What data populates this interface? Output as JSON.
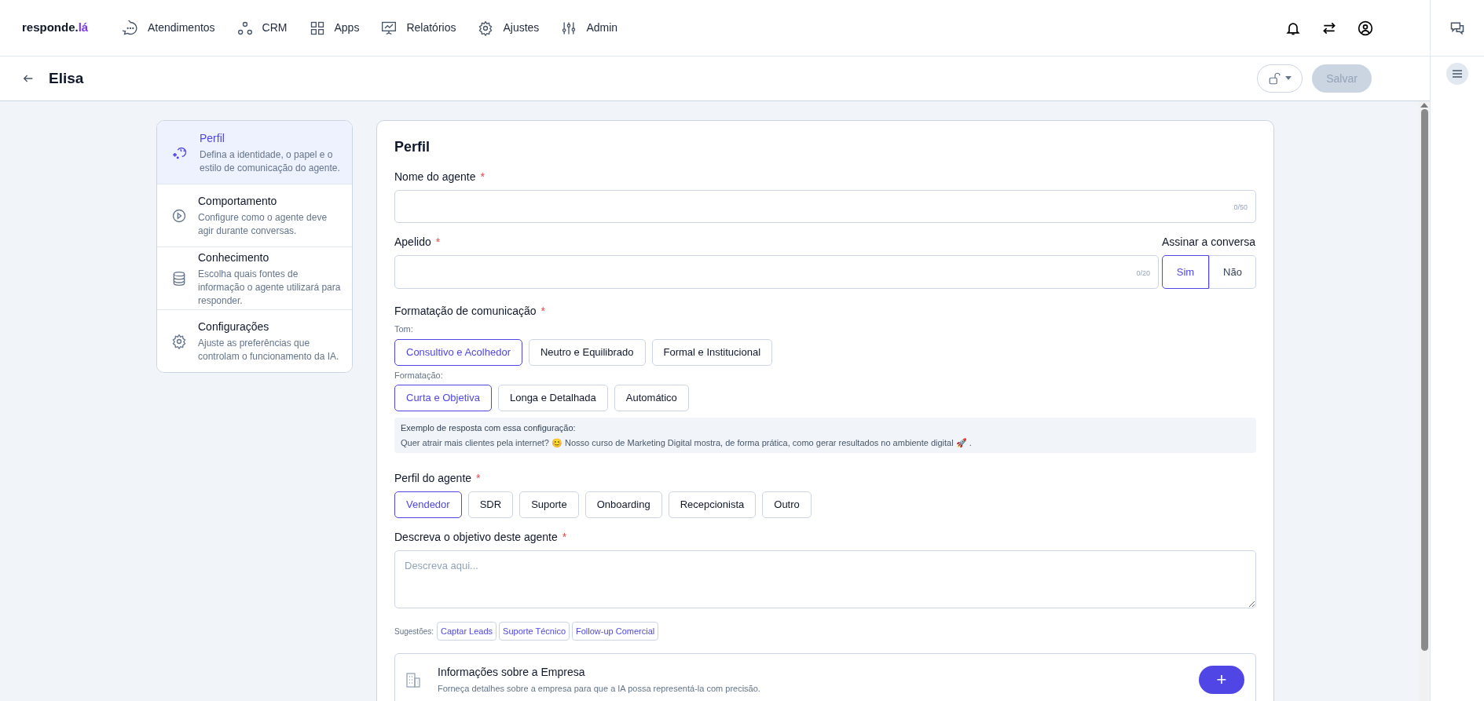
{
  "brand": {
    "name": "responde.",
    "suffix": "lá"
  },
  "nav": [
    {
      "label": "Atendimentos"
    },
    {
      "label": "CRM"
    },
    {
      "label": "Apps"
    },
    {
      "label": "Relatórios"
    },
    {
      "label": "Ajustes"
    },
    {
      "label": "Admin"
    }
  ],
  "header": {
    "title": "Elisa",
    "save_label": "Salvar",
    "save_disabled": true
  },
  "sections": [
    {
      "title": "Perfil",
      "description": "Defina a identidade, o papel e o estilo de comunicação do agente.",
      "selected": true
    },
    {
      "title": "Comportamento",
      "description": "Configure como o agente deve agir durante conversas.",
      "selected": false
    },
    {
      "title": "Conhecimento",
      "description": "Escolha quais fontes de informação o agente utilizará para responder.",
      "selected": false
    },
    {
      "title": "Configurações",
      "description": "Ajuste as preferências que controlam o funcionamento da IA.",
      "selected": false
    }
  ],
  "form": {
    "title": "Perfil",
    "name_field": {
      "label": "Nome do agente",
      "asterisk": "*",
      "counter": "0/50"
    },
    "nickname_field": {
      "label": "Apelido",
      "asterisk": "*",
      "counter": "0/20"
    },
    "sign": {
      "label": "Assinar a conversa",
      "options": [
        {
          "label": "Sim",
          "selected": true
        },
        {
          "label": "Não",
          "selected": false
        }
      ]
    },
    "formatting": {
      "label": "Formatação de comunicação",
      "asterisk": "*",
      "groups": [
        {
          "label": "Tom:",
          "options": [
            {
              "label": "Consultivo e Acolhedor",
              "selected": true
            },
            {
              "label": "Neutro e Equilibrado",
              "selected": false
            },
            {
              "label": "Formal e Institucional",
              "selected": false
            }
          ]
        },
        {
          "label": "Formatação:",
          "options": [
            {
              "label": "Curta e Objetiva",
              "selected": true
            },
            {
              "label": "Longa e Detalhada",
              "selected": false
            },
            {
              "label": "Automático",
              "selected": false
            }
          ]
        }
      ],
      "example": {
        "title": "Exemplo de resposta com essa configuração:",
        "text": "Quer atrair mais clientes pela internet? 😊 Nosso curso de Marketing Digital mostra, de forma prática, como gerar resultados no ambiente digital 🚀 ."
      }
    },
    "agent_profile": {
      "label": "Perfil do agente",
      "asterisk": "*",
      "options": [
        {
          "label": "Vendedor",
          "selected": true
        },
        {
          "label": "SDR",
          "selected": false
        },
        {
          "label": "Suporte",
          "selected": false
        },
        {
          "label": "Onboarding",
          "selected": false
        },
        {
          "label": "Recepcionista",
          "selected": false
        },
        {
          "label": "Outro",
          "selected": false
        }
      ]
    },
    "objective": {
      "label": "Descreva o objetivo deste agente",
      "asterisk": "*",
      "placeholder": "Descreva aqui..."
    },
    "suggestions": {
      "label": "Sugestões:",
      "items": [
        "Captar Leads",
        "Suporte Técnico",
        "Follow-up Comercial"
      ]
    },
    "company_info": {
      "title": "Informações sobre a Empresa",
      "description": "Forneça detalhes sobre a empresa para que a IA possa representá-la com precisão.",
      "add_label": "+"
    }
  }
}
